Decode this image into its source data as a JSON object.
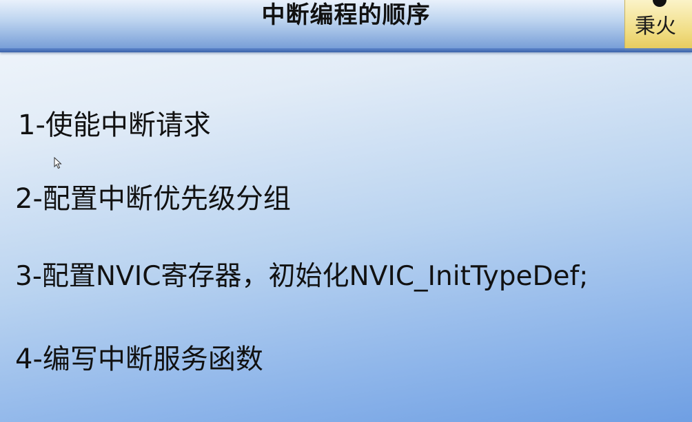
{
  "slide": {
    "title": "中断编程的顺序",
    "logo_text": "秉火",
    "steps": [
      "1-使能中断请求",
      "2-配置中断优先级分组",
      "3-配置NVIC寄存器，初始化NVIC_InitTypeDef;",
      "4-编写中断服务函数"
    ]
  },
  "colors": {
    "title_bar": "#6e97d4",
    "background_top": "#f4f8fc",
    "background_bottom": "#6f9fe3",
    "logo_bg": "#f1de86",
    "text": "#111111"
  },
  "icons": {
    "cursor": "mouse-pointer-icon"
  }
}
